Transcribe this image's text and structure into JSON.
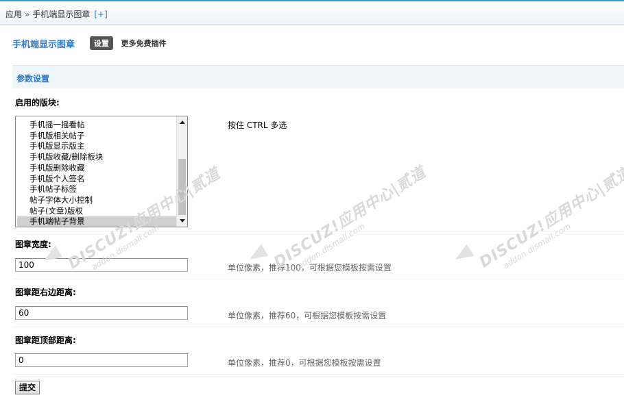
{
  "breadcrumb": {
    "items": [
      "应用",
      "手机端显示图章"
    ],
    "separator": "»",
    "add_label": "[+]"
  },
  "header": {
    "plugin_title": "手机端显示图章",
    "tab_settings": "设置",
    "tab_more": "更多免费插件"
  },
  "section": {
    "title": "参数设置"
  },
  "fields": {
    "enabled_modules": {
      "label": "启用的版块:",
      "hint": "按住 CTRL 多选",
      "options": [
        {
          "text": "手机摇一摇看帖",
          "selected": false
        },
        {
          "text": "手机版相关帖子",
          "selected": false
        },
        {
          "text": "手机版显示版主",
          "selected": false
        },
        {
          "text": "手机版收藏/删除板块",
          "selected": false
        },
        {
          "text": "手机版删除收藏",
          "selected": false
        },
        {
          "text": "手机版个人签名",
          "selected": false
        },
        {
          "text": "手机帖子标签",
          "selected": false
        },
        {
          "text": "帖子字体大小控制",
          "selected": false
        },
        {
          "text": "帖子(文章)版权",
          "selected": false
        },
        {
          "text": "手机端帖子背景",
          "selected": true
        }
      ]
    },
    "stamp_width": {
      "label": "图章宽度:",
      "value": "100",
      "hint": "单位像素，推荐100，可根据您模板按需设置"
    },
    "stamp_right": {
      "label": "图章距右边距离:",
      "value": "60",
      "hint": "单位像素，推荐60，可根据您模板按需设置"
    },
    "stamp_top": {
      "label": "图章距顶部距离:",
      "value": "0",
      "hint": "单位像素，推荐0，可根据您模板按需设置"
    }
  },
  "submit_label": "提交",
  "watermark": {
    "main": "DISCUZ!应用中心|贰道",
    "sub": "addon.dismall.com"
  },
  "colors": {
    "accent": "#2b7acb",
    "section_bg": "#eef5fb",
    "top_line": "#2f9fd6"
  }
}
